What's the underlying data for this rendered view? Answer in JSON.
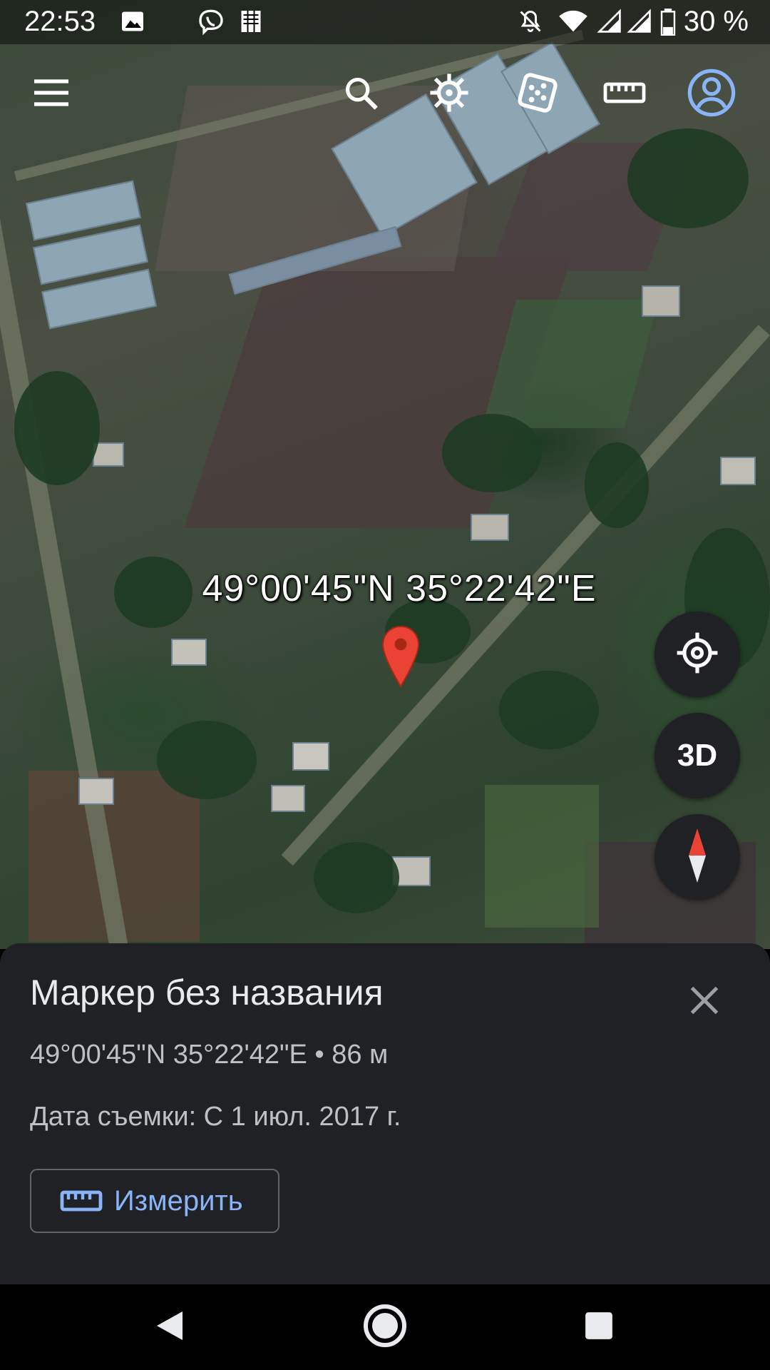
{
  "status_bar": {
    "time": "22:53",
    "battery": "30 %",
    "left_icons": [
      "image-icon",
      "viber-icon",
      "gallery-icon"
    ],
    "right_icons": [
      "bell-off-icon",
      "wifi-icon",
      "signal-icon",
      "signal-icon",
      "battery-icon"
    ]
  },
  "toolbar": {
    "items": [
      "menu-icon",
      "search-icon",
      "voyager-icon",
      "dice-icon",
      "ruler-icon",
      "account-icon"
    ]
  },
  "map": {
    "placemark_label": "49°00'45\"N 35°22'42\"E"
  },
  "fabs": {
    "location": "my-location-icon",
    "three_d": "3D",
    "compass": "compass-icon"
  },
  "sheet": {
    "title": "Маркер без названия",
    "coords": "49°00'45\"N 35°22'42\"E • 86 м",
    "date": "Дата съемки: С 1 июл. 2017 г.",
    "measure_label": "Измерить"
  },
  "colors": {
    "accent": "#8ab4f8",
    "sheet_bg": "#202124",
    "pin": "#ea4335"
  }
}
